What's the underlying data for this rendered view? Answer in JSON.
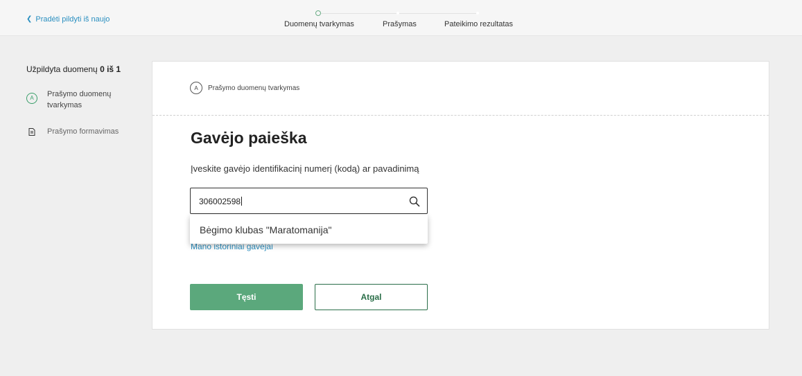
{
  "header": {
    "restart_label": "Pradėti pildyti iš naujo",
    "steps": [
      {
        "label": "Duomenų tvarkymas",
        "state": "current"
      },
      {
        "label": "Prašymas",
        "state": "pending"
      },
      {
        "label": "Pateikimo rezultatas",
        "state": "pending"
      }
    ]
  },
  "sidebar": {
    "progress_prefix": "Užpildyta duomenų",
    "progress_count": "0 iš 1",
    "items": [
      {
        "badge": "A",
        "label": "Prašymo duomenų tvarkymas"
      },
      {
        "label": "Prašymo formavimas"
      }
    ]
  },
  "card": {
    "step_badge": "A",
    "step_label": "Prašymo duomenų tvarkymas",
    "title": "Gavėjo paieška",
    "field_label": "Įveskite gavėjo identifikacinį numerį (kodą) ar pavadinimą",
    "search_value": "306002598",
    "suggestion": "Bėgimo klubas \"Maratomanija\"",
    "history_link": "Mano istoriniai gavėjai",
    "continue_label": "Tęsti",
    "back_label": "Atgal"
  },
  "colors": {
    "accent_green": "#5ba87c",
    "dark_green": "#2a6e48",
    "link_blue": "#2a8fc0"
  }
}
